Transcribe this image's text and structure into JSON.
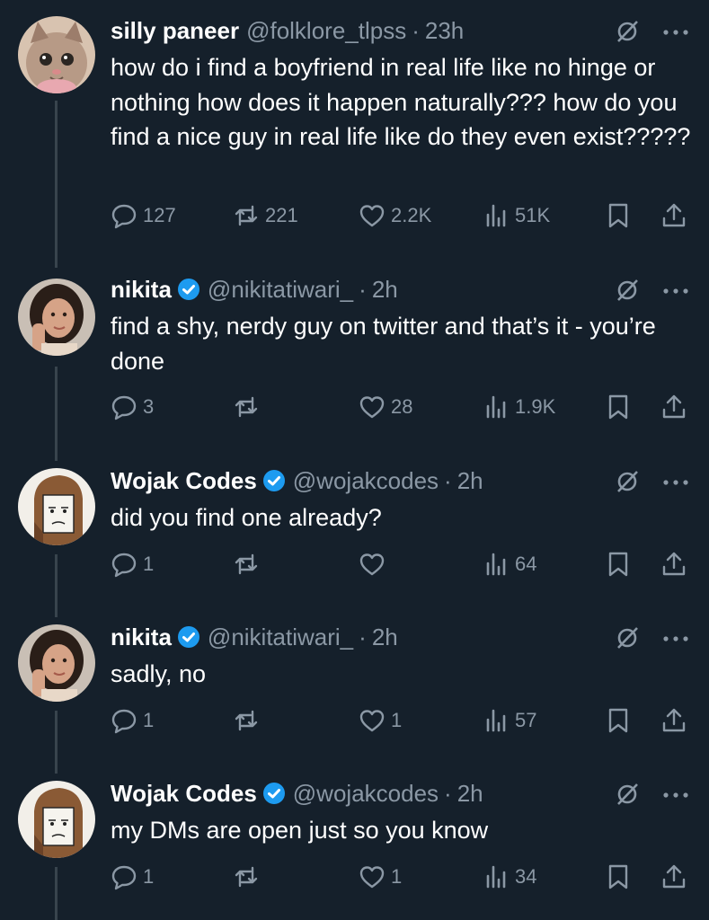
{
  "tweets": [
    {
      "name": "silly paneer",
      "handle": "@folklore_tlpss",
      "dot": "·",
      "time": "23h",
      "verified": false,
      "avatar": "kitten-avatar",
      "text": "how do i find a boyfriend in real life like no hinge or nothing how does it happen naturally??? how do you find a nice guy in real life like do they even exist?????",
      "replies": "127",
      "reposts": "221",
      "likes": "2.2K",
      "views": "51K"
    },
    {
      "name": "nikita",
      "handle": "@nikitatiwari_",
      "dot": "·",
      "time": "2h",
      "verified": true,
      "avatar": "woman-avatar",
      "text": "find a shy, nerdy guy on twitter and that’s it - you’re done",
      "replies": "3",
      "reposts": "",
      "likes": "28",
      "views": "1.9K"
    },
    {
      "name": "Wojak Codes",
      "handle": "@wojakcodes",
      "dot": "·",
      "time": "2h",
      "verified": true,
      "avatar": "wojak-avatar",
      "text": "did you find one already?",
      "replies": "1",
      "reposts": "",
      "likes": "",
      "views": "64"
    },
    {
      "name": "nikita",
      "handle": "@nikitatiwari_",
      "dot": "·",
      "time": "2h",
      "verified": true,
      "avatar": "woman-avatar",
      "text": "sadly, no",
      "replies": "1",
      "reposts": "",
      "likes": "1",
      "views": "57"
    },
    {
      "name": "Wojak Codes",
      "handle": "@wojakcodes",
      "dot": "·",
      "time": "2h",
      "verified": true,
      "avatar": "wojak-avatar",
      "text": "my DMs are open just so you know",
      "replies": "1",
      "reposts": "",
      "likes": "1",
      "views": "34"
    }
  ],
  "colors": {
    "background": "#15202b",
    "text": "#ffffff",
    "muted": "#8b98a5",
    "verified": "#1d9bf0",
    "thread_line": "#38444d"
  }
}
